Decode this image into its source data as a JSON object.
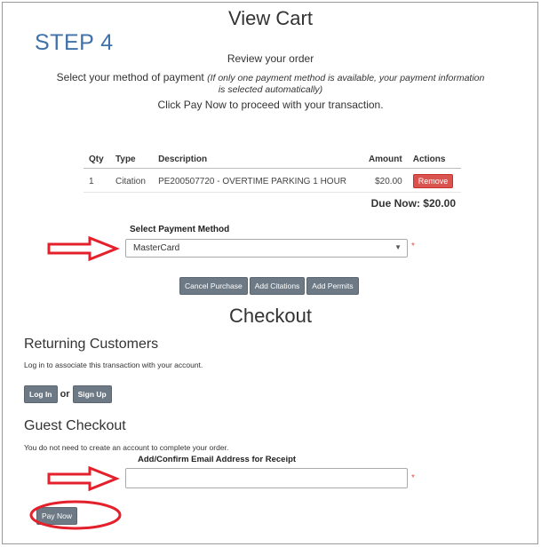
{
  "step_label": "STEP 4",
  "view_cart": {
    "title": "View Cart",
    "review": "Review your order",
    "select_method_prefix": "Select your method of payment",
    "select_method_note_1": "(If only one payment method is available, your payment information",
    "select_method_note_2": "is selected automatically)",
    "pay_now_instruction": "Click Pay Now to proceed with your transaction."
  },
  "cart_table": {
    "headers": {
      "qty": "Qty",
      "type": "Type",
      "description": "Description",
      "amount": "Amount",
      "actions": "Actions"
    },
    "rows": [
      {
        "qty": "1",
        "type": "Citation",
        "description": "PE200507720 - OVERTIME PARKING 1 HOUR",
        "amount": "$20.00",
        "action": "Remove"
      }
    ],
    "due_now": "Due Now: $20.00"
  },
  "payment": {
    "label": "Select Payment Method",
    "selected": "MasterCard",
    "required_mark": "*"
  },
  "buttons": {
    "cancel_purchase": "Cancel Purchase",
    "add_citations": "Add Citations",
    "add_permits": "Add Permits"
  },
  "checkout": {
    "title": "Checkout",
    "returning_heading": "Returning Customers",
    "returning_text": "Log in to associate this transaction with your account.",
    "log_in": "Log In",
    "or": "or",
    "sign_up": "Sign Up",
    "guest_heading": "Guest Checkout",
    "guest_text": "You do not need to create an account to complete your order.",
    "email_label": "Add/Confirm Email Address for Receipt",
    "email_value": "",
    "required_mark": "*",
    "pay_now": "Pay Now"
  },
  "colors": {
    "annotation_red": "#e3202b",
    "step_blue": "#3f72a8",
    "remove_red": "#d9534f",
    "button_gray": "#6d7a86"
  }
}
